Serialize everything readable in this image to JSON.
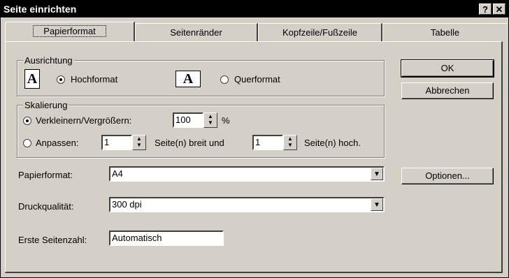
{
  "window": {
    "title": "Seite einrichten",
    "help_label": "?",
    "close_label": "✕"
  },
  "tabs": [
    {
      "label": "Papierformat"
    },
    {
      "label": "Seitenränder"
    },
    {
      "label": "Kopfzeile/Fußzeile"
    },
    {
      "label": "Tabelle"
    }
  ],
  "orientation": {
    "group_label": "Ausrichtung",
    "icon_glyph": "A",
    "portrait_label": "Hochformat",
    "landscape_label": "Querformat",
    "selected": "portrait"
  },
  "scaling": {
    "group_label": "Skalierung",
    "reduce_label": "Verkleinern/Vergrößern:",
    "reduce_value": "100",
    "percent": "%",
    "fit_label": "Anpassen:",
    "fit_wide_value": "1",
    "fit_wide_label": "Seite(n) breit und",
    "fit_tall_value": "1",
    "fit_tall_label": "Seite(n) hoch.",
    "selected": "reduce"
  },
  "paper": {
    "label": "Papierformat:",
    "value": "A4"
  },
  "quality": {
    "label": "Druckqualität:",
    "value": "300 dpi"
  },
  "first_page": {
    "label": "Erste Seitenzahl:",
    "value": "Automatisch"
  },
  "buttons": {
    "ok": "OK",
    "cancel": "Abbrechen",
    "options": "Optionen..."
  }
}
